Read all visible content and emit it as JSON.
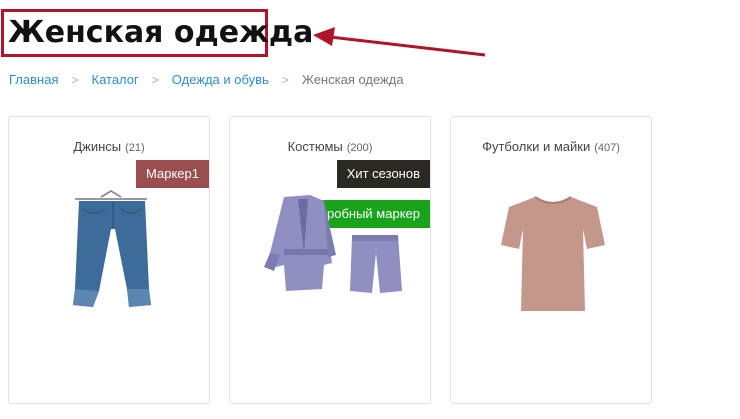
{
  "page": {
    "title": "Женская одежда"
  },
  "breadcrumb": {
    "items": [
      "Главная",
      "Каталог",
      "Одежда и обувь"
    ],
    "current": "Женская одежда",
    "separator": ">"
  },
  "categories": [
    {
      "name": "Джинсы",
      "count": "(21)",
      "markers": [
        "Маркер1"
      ],
      "image": "jeans"
    },
    {
      "name": "Костюмы",
      "count": "(200)",
      "markers": [
        "Хит сезонов",
        "Пробный маркер"
      ],
      "image": "suit"
    },
    {
      "name": "Футболки и майки",
      "count": "(407)",
      "markers": [],
      "image": "tshirt"
    }
  ],
  "colors": {
    "highlight_border": "#b0142a",
    "link": "#2f8ed0",
    "marker1": "#9b4e4e",
    "marker_hit": "#2b2a22",
    "marker_probe": "#18a31b"
  }
}
